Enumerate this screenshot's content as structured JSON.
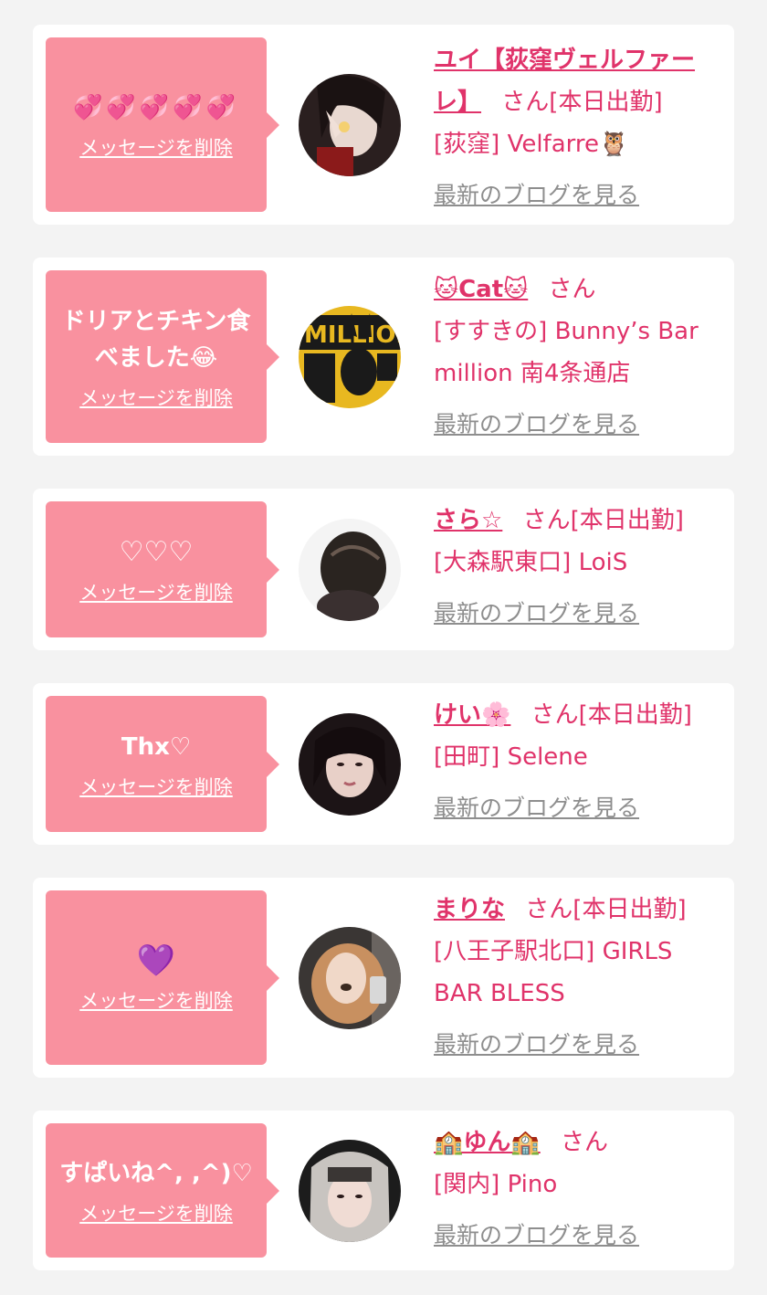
{
  "colors": {
    "accent": "#e0336a",
    "bubble": "#f9919f",
    "card": "#ffffff",
    "bg": "#f3f3f3",
    "link_gray": "#8e8e8e"
  },
  "delete_label": "メッセージを削除",
  "blog_label": "最新のブログを見る",
  "san_label": "さん",
  "items": [
    {
      "message": "💞💞💞💞💞",
      "name": "ユイ【荻窪ヴェルファーレ】",
      "status": "[本日出勤]",
      "area": "[荻窪]",
      "shop": "Velfarre🦉"
    },
    {
      "message": "ドリアとチキン食べました😂",
      "name": "🐱Cat🐱",
      "status": "",
      "area": "[すすきの]",
      "shop": "Bunny’s Bar million 南4条通店"
    },
    {
      "message": "♡♡♡",
      "name": "さら☆",
      "status": "[本日出勤]",
      "area": "[大森駅東口]",
      "shop": "LoiS"
    },
    {
      "message": "Thx♡",
      "name": "けい🌸",
      "status": "[本日出勤]",
      "area": "[田町]",
      "shop": "Selene"
    },
    {
      "message": "💜",
      "name": "まりな",
      "status": "[本日出勤]",
      "area": "[八王子駅北口]",
      "shop": "GIRLS BAR BLESS"
    },
    {
      "message": "すぱいね^, ,^)♡",
      "name": "🏫ゆん🏫",
      "status": "",
      "area": "[関内]",
      "shop": "Pino"
    }
  ]
}
